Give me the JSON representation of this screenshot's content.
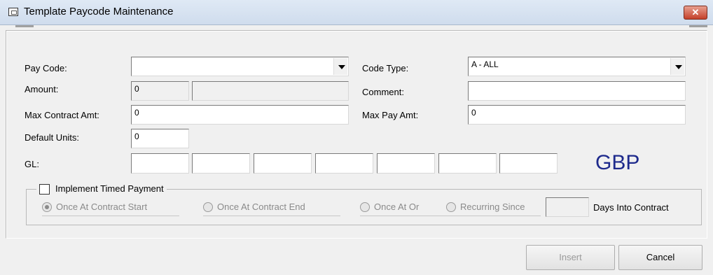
{
  "window": {
    "title": "Template Paycode Maintenance",
    "close_glyph": "✕"
  },
  "form": {
    "pay_code": {
      "label": "Pay Code:",
      "value": ""
    },
    "code_type": {
      "label": "Code Type:",
      "value": "A - ALL"
    },
    "amount": {
      "label": "Amount:",
      "value": "0",
      "value2": ""
    },
    "comment": {
      "label": "Comment:",
      "value": ""
    },
    "max_contract_amt": {
      "label": "Max Contract Amt:",
      "value": "0"
    },
    "max_pay_amt": {
      "label": "Max Pay Amt:",
      "value": "0"
    },
    "default_units": {
      "label": "Default Units:",
      "value": "0"
    },
    "gl": {
      "label": "GL:",
      "segments": [
        "",
        "",
        "",
        "",
        "",
        "",
        ""
      ]
    },
    "currency": "GBP"
  },
  "timed_payment": {
    "label": "Implement Timed Payment",
    "checked": false,
    "options": [
      {
        "label": "Once At Contract Start",
        "checked": true
      },
      {
        "label": "Once At Contract End",
        "checked": false
      },
      {
        "label": "Once At Or",
        "checked": false
      },
      {
        "label": "Recurring Since",
        "checked": false
      }
    ],
    "days_value": "",
    "days_label": "Days Into Contract"
  },
  "buttons": {
    "insert": "Insert",
    "cancel": "Cancel"
  }
}
